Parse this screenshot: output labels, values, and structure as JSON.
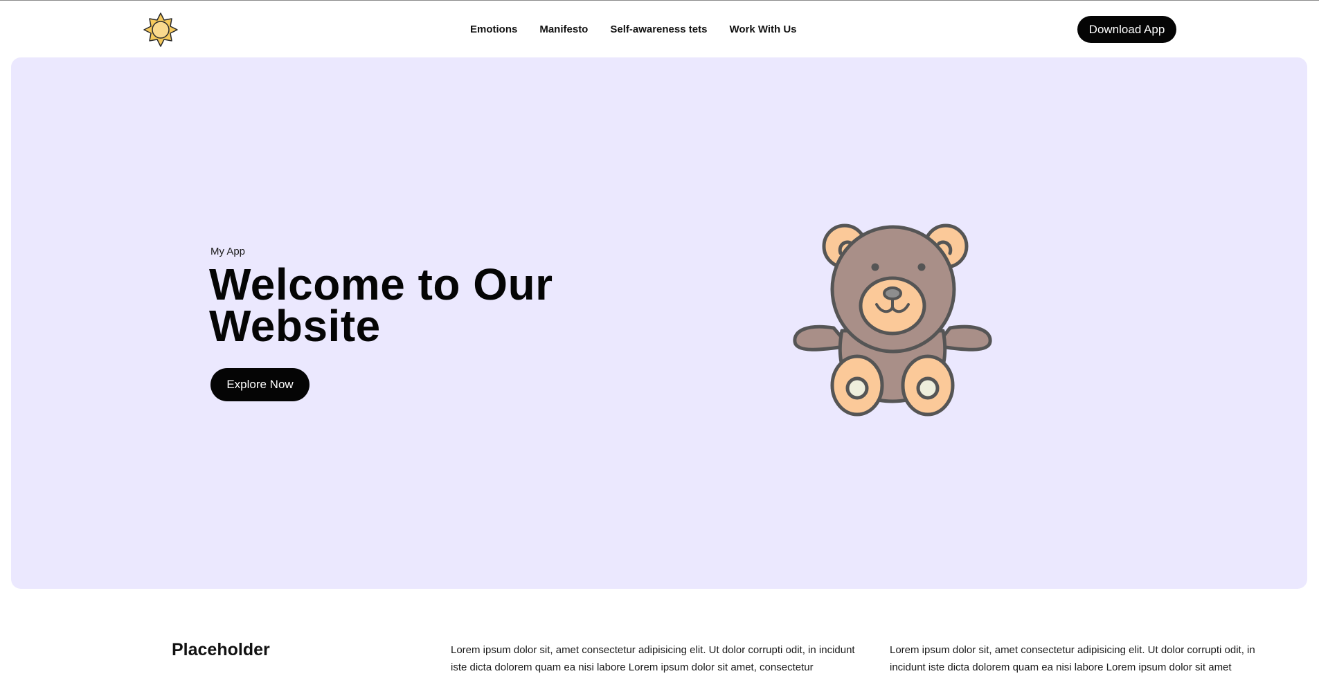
{
  "header": {
    "logo_icon": "sun-icon",
    "nav": [
      {
        "label": "Emotions"
      },
      {
        "label": "Manifesto"
      },
      {
        "label": "Self-awareness tets"
      },
      {
        "label": "Work With Us"
      }
    ],
    "download_label": "Download App"
  },
  "hero": {
    "eyebrow": "My App",
    "title": "Welcome to Our Website",
    "cta_label": "Explore Now",
    "illustration": "teddy-bear-icon",
    "background": "#ebe8fe"
  },
  "content": {
    "heading": "Placeholder",
    "columns": [
      {
        "text": "Lorem ipsum dolor sit, amet consectetur adipisicing elit. Ut dolor corrupti odit, in incidunt iste dicta dolorem quam ea nisi labore Lorem ipsum dolor sit amet, consectetur"
      },
      {
        "text": "Lorem ipsum dolor sit, amet consectetur adipisicing elit. Ut dolor corrupti odit, in incidunt iste dicta dolorem quam ea nisi labore Lorem ipsum dolor sit amet"
      }
    ]
  },
  "colors": {
    "accent": "#050505",
    "bear_body": "#a98f88",
    "bear_paw": "#fbc999",
    "outline": "#555555"
  }
}
